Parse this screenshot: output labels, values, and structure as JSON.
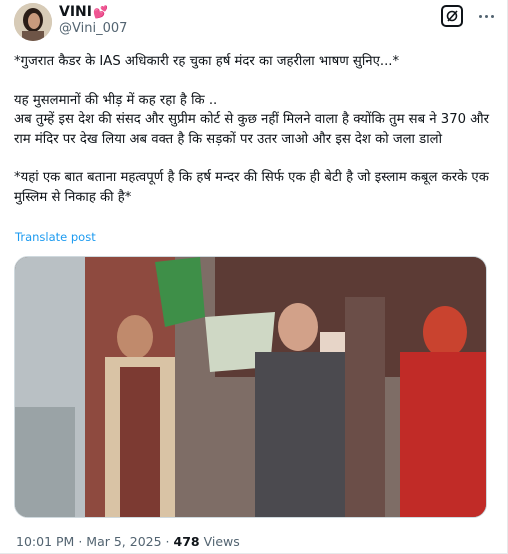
{
  "author": {
    "name": "VINI",
    "name_emoji": "💕",
    "handle": "@Vini_007",
    "avatar_icon": "profile-photo"
  },
  "post": {
    "line1": "*गुजरात कैडर के IAS अधिकारी रह चुका हर्ष मंदर का जहरीला भाषण सुनिए...*",
    "line2": "यह मुसलमानों की भीड़ में कह रहा है कि ..",
    "line3": "अब तुम्हें इस देश की संसद और सुप्रीम कोर्ट से कुछ नहीं मिलने वाला है क्योंकि तुम सब ने 370 और राम मंदिर पर देख लिया अब वक्त है कि सड़कों पर उतर जाओ और इस देश को जला डालो",
    "line4": "*यहां एक बात बताना महत्वपूर्ण है कि हर्ष मन्दर  की सिर्फ एक ही बेटी है जो इस्लाम कबूल करके एक मुस्लिम से निकाह की है*",
    "translate_label": "Translate post"
  },
  "media": {
    "icon": "video-thumbnail"
  },
  "footer": {
    "time": "10:01 PM",
    "separator": "·",
    "date": "Mar 5, 2025",
    "views_count": "478",
    "views_label": "Views"
  },
  "icons": {
    "grok": "grok-icon",
    "more": "more-icon"
  },
  "colors": {
    "link": "#1d9bf0",
    "secondary": "#536471",
    "heart": "#e0245e"
  }
}
